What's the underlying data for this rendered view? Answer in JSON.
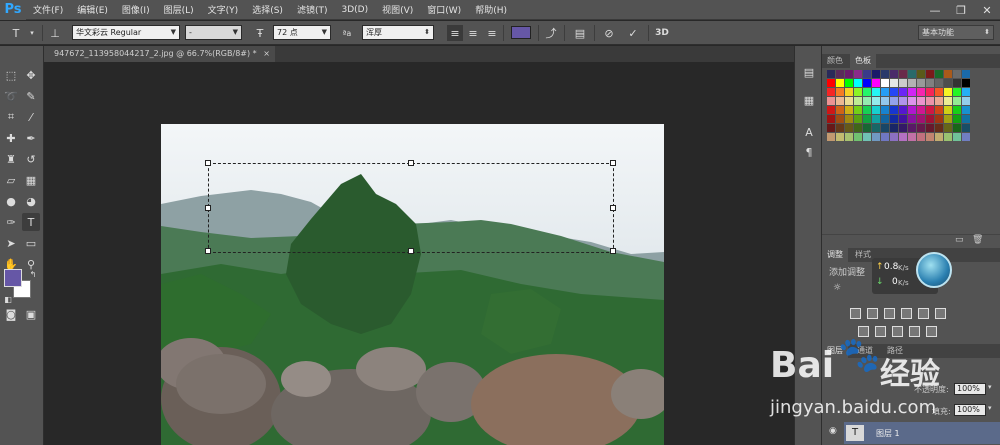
{
  "app": {
    "logo": "Ps"
  },
  "menu": [
    "文件(F)",
    "编辑(E)",
    "图像(I)",
    "图层(L)",
    "文字(Y)",
    "选择(S)",
    "滤镜(T)",
    "3D(D)",
    "视图(V)",
    "窗口(W)",
    "帮助(H)"
  ],
  "window_controls": {
    "minimize": "—",
    "restore": "❐",
    "close": "✕"
  },
  "options": {
    "tool_icon": "T",
    "font_family": "华文彩云 Regular",
    "font_style": "-",
    "font_size": "72 点",
    "aa_label": "ªa",
    "aa_mode": "浑厚",
    "text_color": "#6657a6",
    "workspace": "基本功能"
  },
  "document": {
    "tab_title": "947672_113958044217_2.jpg @ 66.7%(RGB/8#) *",
    "tab_close": "×"
  },
  "tools": {
    "foreground_color": "#6657a6",
    "background_color": "#ffffff"
  },
  "panels": {
    "color_tabs": [
      "颜色",
      "色板"
    ],
    "adjust_tabs": [
      "调整",
      "样式"
    ],
    "add_adjust_label": "添加调整",
    "net_speed": {
      "up": "0.8",
      "down": "0",
      "unit": "K/s",
      "up_arrow": "↑",
      "down_arrow": "↓"
    },
    "layers_tabs": [
      "图层",
      "通道",
      "路径"
    ],
    "opacity_label": "不透明度:",
    "opacity_value": "100%",
    "fill_label": "填充:",
    "fill_value": "100%",
    "layer_name": "图层 1",
    "layer_icon": "T"
  },
  "watermark": {
    "brand": "Bai",
    "brand2": "经验",
    "url": "jingyan.baidu.com"
  }
}
